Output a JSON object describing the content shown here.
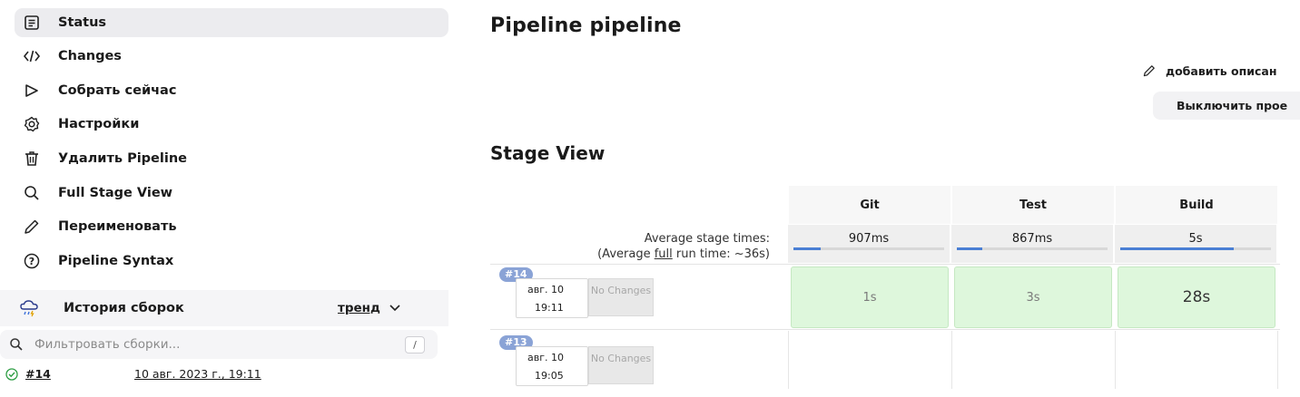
{
  "sidebar": {
    "items": [
      {
        "label": "Status",
        "icon": "status-doc-icon",
        "active": true
      },
      {
        "label": "Changes",
        "icon": "code-icon",
        "active": false
      },
      {
        "label": "Собрать сейчас",
        "icon": "play-icon",
        "active": false
      },
      {
        "label": "Настройки",
        "icon": "gear-icon",
        "active": false
      },
      {
        "label": "Удалить Pipeline",
        "icon": "trash-icon",
        "active": false
      },
      {
        "label": "Full Stage View",
        "icon": "search-icon",
        "active": false
      },
      {
        "label": "Переименовать",
        "icon": "pencil-icon",
        "active": false
      },
      {
        "label": "Pipeline Syntax",
        "icon": "help-icon",
        "active": false
      }
    ],
    "history": {
      "title": "История сборок",
      "trend_label": "тренд",
      "filter_placeholder": "Фильтровать сборки...",
      "filter_shortcut": "/",
      "builds": [
        {
          "number": "#14",
          "date": "10 авг. 2023 г., 19:11",
          "status": "success"
        }
      ]
    }
  },
  "main": {
    "title": "Pipeline pipeline",
    "add_description": "добавить описан",
    "disable_project": "Выключить прое",
    "stage_view_title": "Stage View",
    "avg_label_line1": "Average stage times:",
    "avg_label_line2_prefix": "(Average ",
    "avg_label_line2_link": "full",
    "avg_label_line2_suffix": " run time: ~36s)",
    "stages": [
      {
        "name": "Git",
        "avg": "907ms",
        "avg_fraction": 0.18
      },
      {
        "name": "Test",
        "avg": "867ms",
        "avg_fraction": 0.17
      },
      {
        "name": "Build",
        "avg": "5s",
        "avg_fraction": 0.75
      }
    ],
    "runs": [
      {
        "badge": "#14",
        "date": "авг. 10",
        "time": "19:11",
        "changes": "No Changes",
        "durations": [
          "1s",
          "3s",
          "28s"
        ],
        "status": "success"
      },
      {
        "badge": "#13",
        "date": "авг. 10",
        "time": "19:05",
        "changes": "No Changes",
        "durations": [
          "",
          "",
          ""
        ],
        "status": "pending"
      }
    ]
  },
  "colors": {
    "success_bg": "#def7dc",
    "active_item_bg": "#ececef",
    "bar_fill": "#4a7fd4",
    "badge_bg": "#8aa3d6"
  }
}
